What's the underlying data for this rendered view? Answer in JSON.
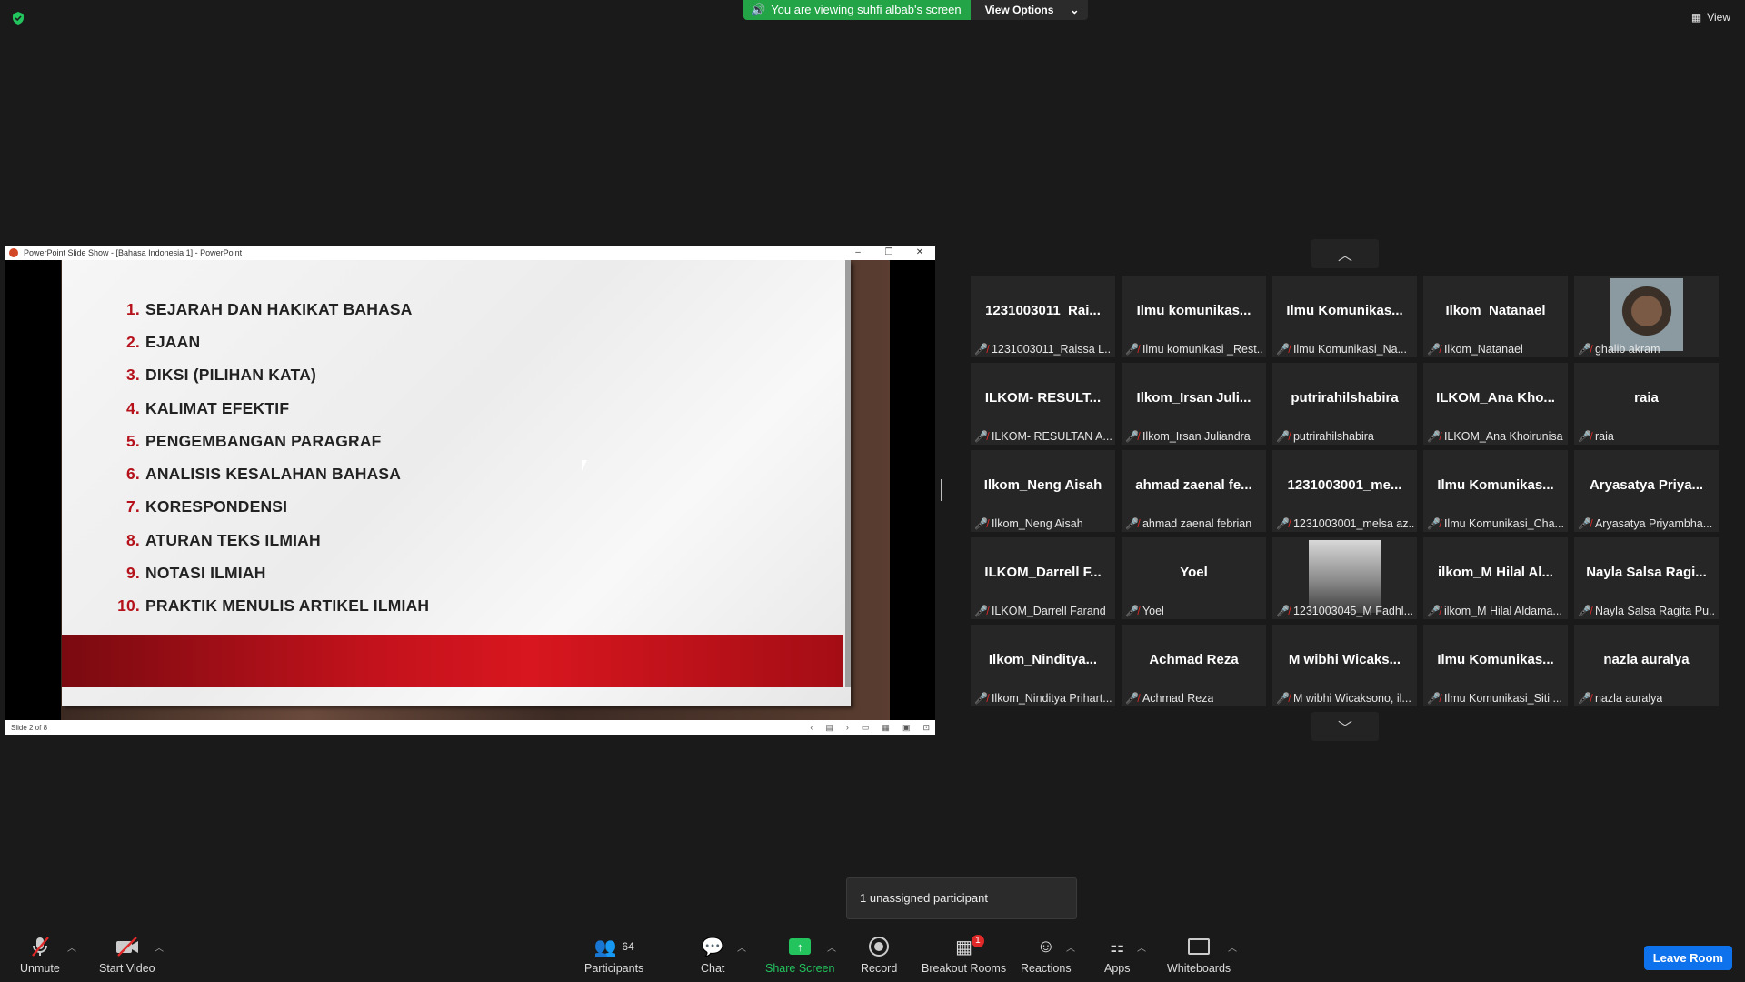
{
  "banner": {
    "viewing": "You are viewing suhfi albab's screen",
    "view_options": "View Options",
    "view": "View"
  },
  "ppt": {
    "title": "PowerPoint Slide Show - [Bahasa Indonesia 1] - PowerPoint",
    "status": "Slide 2 of 8",
    "items": [
      {
        "num": "1.",
        "text": "SEJARAH DAN HAKIKAT BAHASA"
      },
      {
        "num": "2.",
        "text": "EJAAN"
      },
      {
        "num": "3.",
        "text": "DIKSI (PILIHAN KATA)"
      },
      {
        "num": "4.",
        "text": "KALIMAT EFEKTIF"
      },
      {
        "num": "5.",
        "text": "PENGEMBANGAN PARAGRAF"
      },
      {
        "num": "6.",
        "text": "ANALISIS KESALAHAN BAHASA"
      },
      {
        "num": "7.",
        "text": "KORESPONDENSI"
      },
      {
        "num": "8.",
        "text": "ATURAN TEKS ILMIAH"
      },
      {
        "num": "9.",
        "text": "NOTASI ILMIAH"
      },
      {
        "num": "10.",
        "text": "PRAKTIK MENULIS ARTIKEL ILMIAH"
      }
    ]
  },
  "participants": [
    {
      "big": "1231003011_Rai...",
      "small": "1231003011_Raissa L..."
    },
    {
      "big": "Ilmu komunikas...",
      "small": "Ilmu komunikasi _Rest..."
    },
    {
      "big": "Ilmu Komunikas...",
      "small": "Ilmu Komunikasi_Na..."
    },
    {
      "big": "Ilkom_Natanael",
      "small": "Ilkom_Natanael"
    },
    {
      "big": "",
      "small": "ghalib akram",
      "video": true
    },
    {
      "big": "ILKOM- RESULT...",
      "small": "ILKOM- RESULTAN A..."
    },
    {
      "big": "Ilkom_Irsan Juli...",
      "small": "Ilkom_Irsan Juliandra"
    },
    {
      "big": "putrirahilshabira",
      "small": "putrirahilshabira"
    },
    {
      "big": "ILKOM_Ana Kho...",
      "small": "ILKOM_Ana Khoirunisa"
    },
    {
      "big": "raia",
      "small": "raia"
    },
    {
      "big": "Ilkom_Neng Aisah",
      "small": "Ilkom_Neng Aisah"
    },
    {
      "big": "ahmad zaenal fe...",
      "small": "ahmad zaenal febrian"
    },
    {
      "big": "1231003001_me...",
      "small": "1231003001_melsa az..."
    },
    {
      "big": "Ilmu Komunikas...",
      "small": "Ilmu Komunikasi_Cha..."
    },
    {
      "big": "Aryasatya Priya...",
      "small": "Aryasatya Priyambha..."
    },
    {
      "big": "ILKOM_Darrell F...",
      "small": "ILKOM_Darrell Farand"
    },
    {
      "big": "Yoel",
      "small": "Yoel"
    },
    {
      "big": "",
      "small": "1231003045_M Fadhl...",
      "video": true
    },
    {
      "big": "ilkom_M Hilal Al...",
      "small": "ilkom_M Hilal Aldama..."
    },
    {
      "big": "Nayla Salsa Ragi...",
      "small": "Nayla Salsa Ragita Pu..."
    },
    {
      "big": "Ilkom_Ninditya...",
      "small": "Ilkom_Ninditya Prihart..."
    },
    {
      "big": "Achmad Reza",
      "small": "Achmad Reza"
    },
    {
      "big": "M wibhi Wicaks...",
      "small": "M wibhi Wicaksono, il..."
    },
    {
      "big": "Ilmu Komunikas...",
      "small": "Ilmu Komunikasi_Siti ..."
    },
    {
      "big": "nazla auralya",
      "small": "nazla auralya"
    }
  ],
  "popup": "1 unassigned participant",
  "toolbar": {
    "unmute": "Unmute",
    "start_video": "Start Video",
    "participants": "Participants",
    "participants_count": "64",
    "chat": "Chat",
    "share": "Share Screen",
    "record": "Record",
    "breakout": "Breakout Rooms",
    "breakout_badge": "1",
    "reactions": "Reactions",
    "apps": "Apps",
    "whiteboards": "Whiteboards",
    "leave": "Leave Room"
  },
  "colors": {
    "share_green": "#23a447",
    "leave_blue": "#0e72ed",
    "slide_red": "#b5121b"
  }
}
